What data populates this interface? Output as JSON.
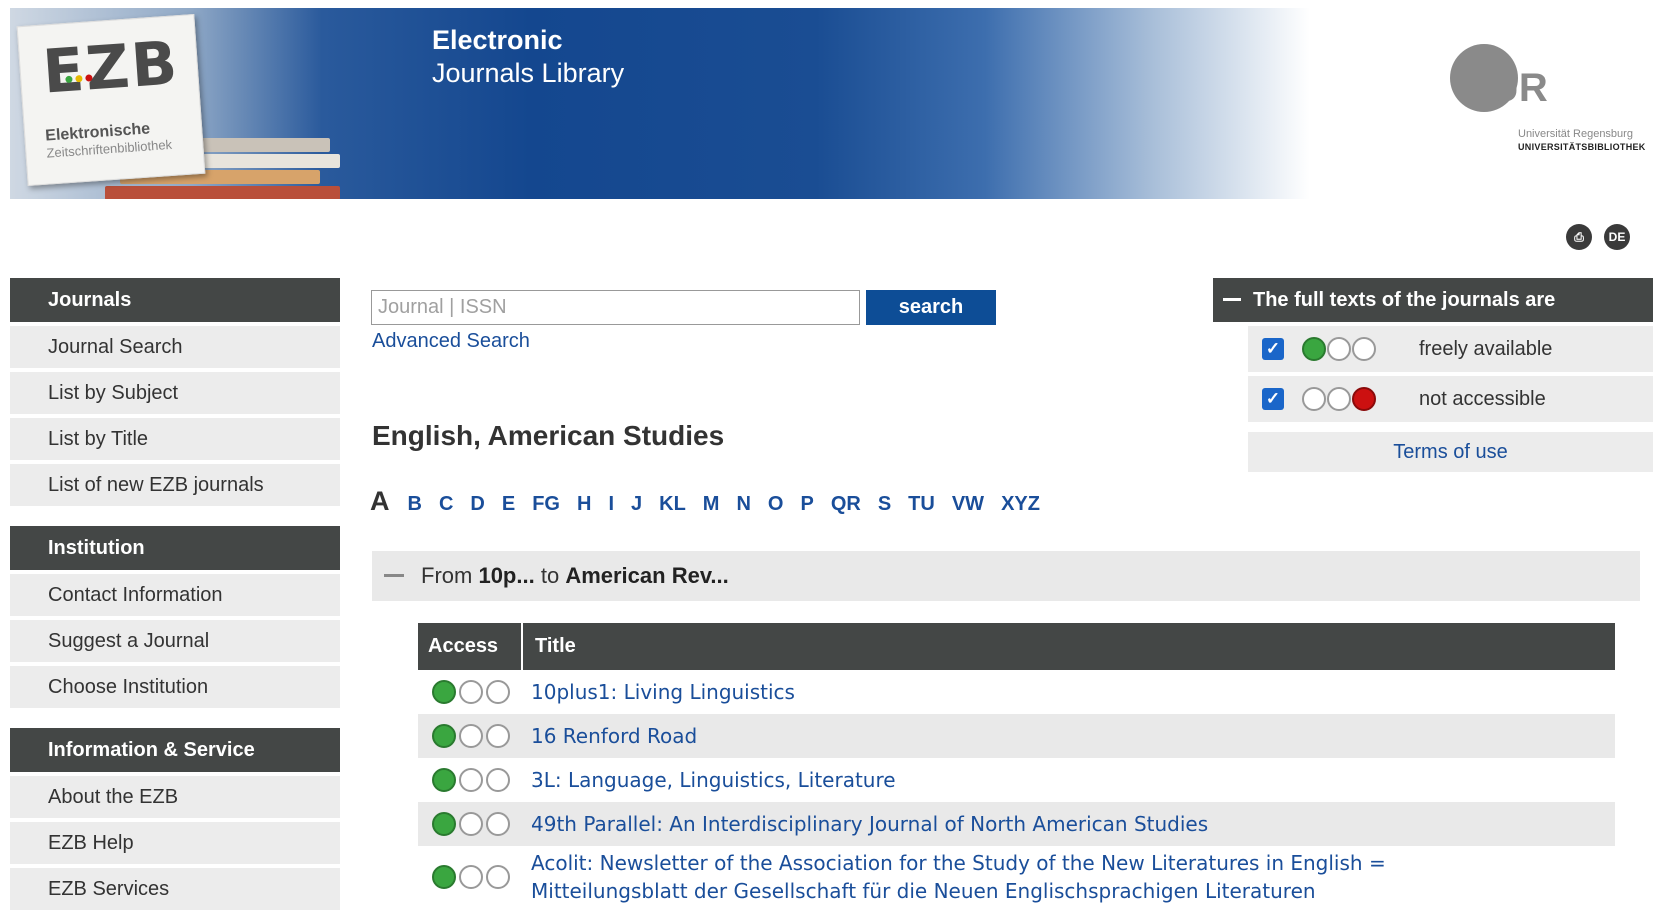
{
  "header": {
    "logo_text": "EZB",
    "logo_sub1": "Elektronische",
    "logo_sub2": "Zeitschriftenbibliothek",
    "title_line1": "Electronic",
    "title_line2": "Journals Library",
    "ur_letters": "UR",
    "ur_text1": "Universität Regensburg",
    "ur_text2": "UNIVERSITÄTSBIBLIOTHEK"
  },
  "top_icons": {
    "print": "⎙",
    "language": "DE"
  },
  "sidebar": {
    "sections": [
      {
        "title": "Journals",
        "items": [
          "Journal Search",
          "List by Subject",
          "List by Title",
          "List of new EZB journals"
        ]
      },
      {
        "title": "Institution",
        "items": [
          "Contact Information",
          "Suggest a Journal",
          "Choose Institution"
        ]
      },
      {
        "title": "Information & Service",
        "items": [
          "About the EZB",
          "EZB Help",
          "EZB Services"
        ]
      }
    ]
  },
  "search": {
    "placeholder": "Journal | ISSN",
    "value": "",
    "button": "search",
    "advanced": "Advanced Search"
  },
  "subject_title": "English, American Studies",
  "alphabet": {
    "active": "A",
    "letters": [
      "B",
      "C",
      "D",
      "E",
      "FG",
      "H",
      "I",
      "J",
      "KL",
      "M",
      "N",
      "O",
      "P",
      "QR",
      "S",
      "TU",
      "VW",
      "XYZ"
    ]
  },
  "range": {
    "prefix": "From",
    "from": "10p...",
    "mid": "to",
    "to": "American Rev..."
  },
  "table": {
    "headers": {
      "access": "Access",
      "title": "Title"
    },
    "rows": [
      {
        "access": "free",
        "title": "10plus1: Living Linguistics"
      },
      {
        "access": "free",
        "title": "16 Renford Road"
      },
      {
        "access": "free",
        "title": "3L: Language, Linguistics, Literature"
      },
      {
        "access": "free",
        "title": "49th Parallel: An Interdisciplinary Journal of North American Studies"
      },
      {
        "access": "free",
        "title": "Acolit: Newsletter of the Association for the Study of the New Literatures in English = Mitteilungsblatt der Gesellschaft für die Neuen Englischsprachigen Literaturen"
      }
    ]
  },
  "right_panel": {
    "title": "The full texts of the journals are",
    "filters": [
      {
        "label": "freely available",
        "checked": true,
        "color": "green"
      },
      {
        "label": "not accessible",
        "checked": true,
        "color": "red"
      }
    ],
    "terms": "Terms of use"
  },
  "colors": {
    "header_blue": "#14478f",
    "link_blue": "#1a4e9a",
    "dark_bar": "#444746",
    "access_green": "#3aa640",
    "access_red": "#cc1010",
    "button_blue": "#0d4d96"
  }
}
